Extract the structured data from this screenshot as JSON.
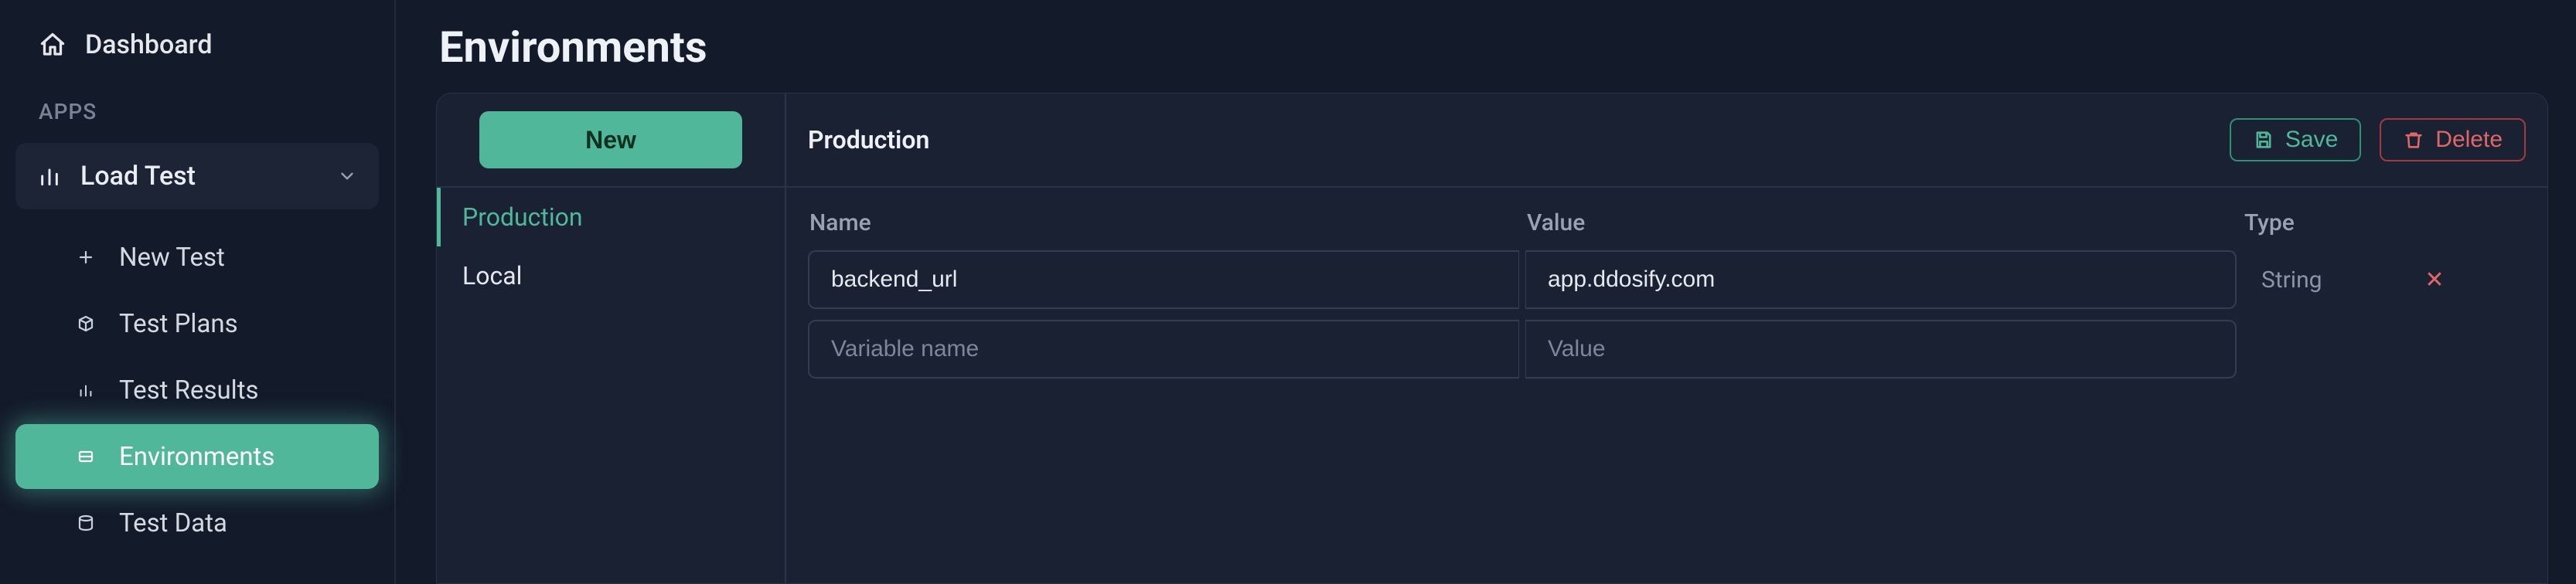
{
  "sidebar": {
    "dashboard_label": "Dashboard",
    "section_label": "APPS",
    "app_selector_label": "Load Test",
    "items": [
      {
        "label": "New Test"
      },
      {
        "label": "Test Plans"
      },
      {
        "label": "Test Results"
      },
      {
        "label": "Environments"
      },
      {
        "label": "Test Data"
      }
    ]
  },
  "page": {
    "title": "Environments"
  },
  "env_list": {
    "new_button": "New",
    "items": [
      {
        "label": "Production"
      },
      {
        "label": "Local"
      }
    ]
  },
  "detail": {
    "title": "Production",
    "save_label": "Save",
    "delete_label": "Delete",
    "columns": {
      "name": "Name",
      "value": "Value",
      "type": "Type"
    },
    "rows": [
      {
        "name": "backend_url",
        "value": "app.ddosify.com",
        "type": "String"
      }
    ],
    "new_row": {
      "name_placeholder": "Variable name",
      "value_placeholder": "Value"
    }
  }
}
